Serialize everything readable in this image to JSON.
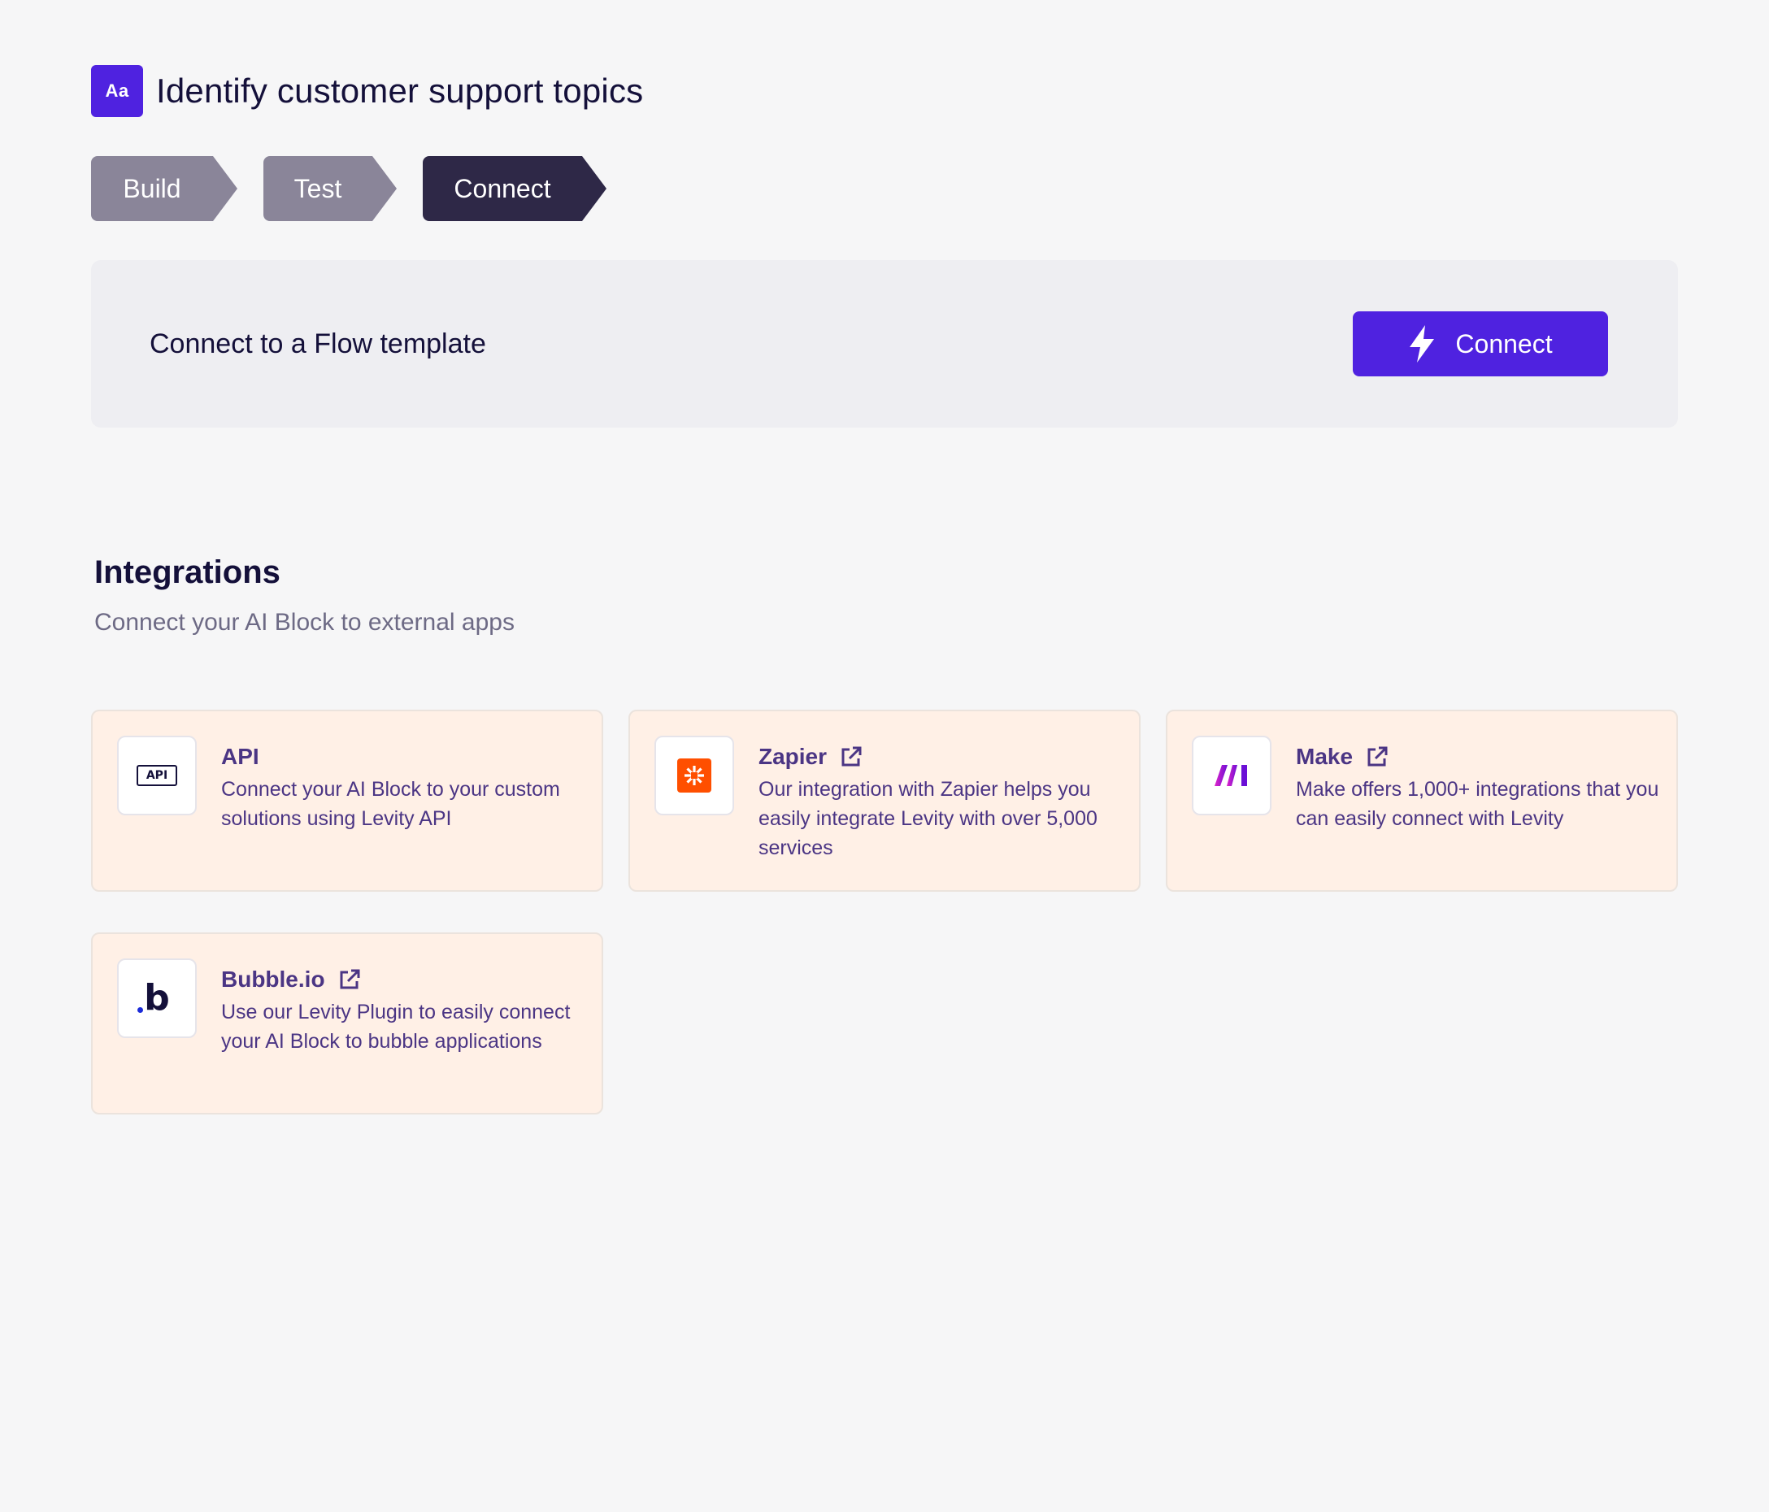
{
  "header": {
    "badge": "Aa",
    "title": "Identify customer support topics"
  },
  "steps": [
    {
      "label": "Build",
      "state": "inactive"
    },
    {
      "label": "Test",
      "state": "inactive"
    },
    {
      "label": "Connect",
      "state": "active"
    }
  ],
  "connect_panel": {
    "title": "Connect to a Flow template",
    "button_label": "Connect",
    "button_icon": "lightning-bolt-icon"
  },
  "integrations": {
    "title": "Integrations",
    "subtitle": "Connect your AI Block to external apps",
    "cards": [
      {
        "title": "API",
        "icon": "api-icon",
        "icon_text": "API",
        "external": false,
        "description": "Connect your AI Block to your custom solutions using Levity API"
      },
      {
        "title": "Zapier",
        "icon": "zapier-icon",
        "external": true,
        "description": "Our integration with Zapier helps you easily integrate Levity with over 5,000 services"
      },
      {
        "title": "Make",
        "icon": "make-icon",
        "external": true,
        "description": "Make offers 1,000+ integrations that you can easily connect with Levity"
      },
      {
        "title": "Bubble.io",
        "icon": "bubble-icon",
        "icon_text": "b",
        "external": true,
        "description": "Use our Levity Plugin to easily connect your AI Block to bubble applications"
      }
    ]
  },
  "colors": {
    "accent": "#4f22e0",
    "step_active": "#2e2847",
    "step_inactive": "#8a8599",
    "card_bg": "#fff0e6",
    "card_text": "#4b3584",
    "zapier_orange": "#ff4f00"
  }
}
